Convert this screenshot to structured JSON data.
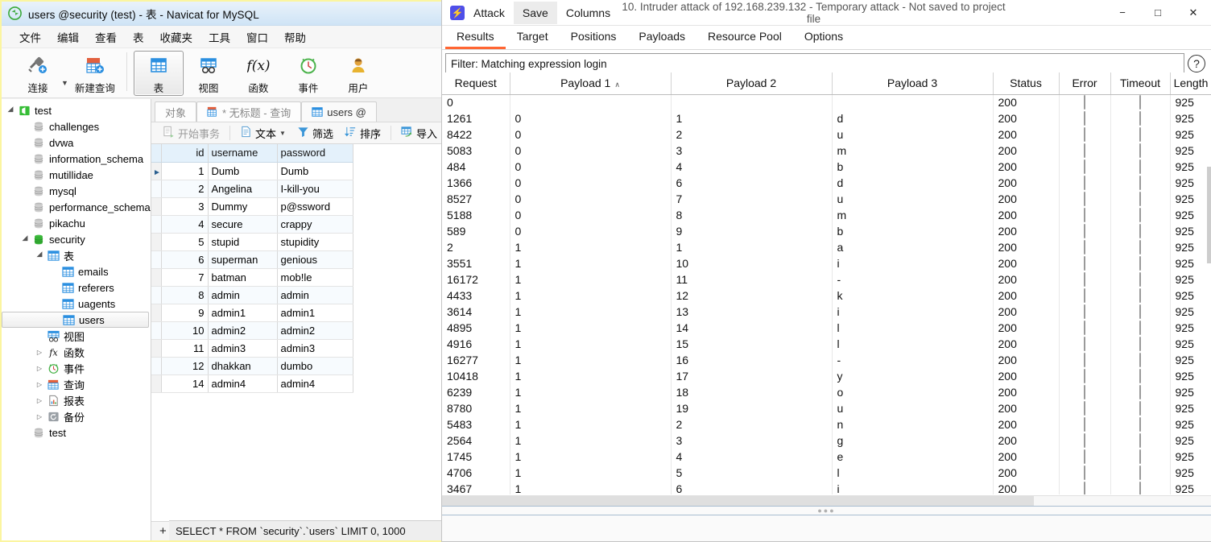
{
  "navicat": {
    "window_title": "users @security (test) - 表 - Navicat for MySQL",
    "app_icon": "navicat-logo-icon",
    "menus": [
      "文件",
      "编辑",
      "查看",
      "表",
      "收藏夹",
      "工具",
      "窗口",
      "帮助"
    ],
    "toolbar": [
      {
        "label": "连接",
        "icon": "connection-icon",
        "selected": false,
        "has_caret": true
      },
      {
        "label": "新建查询",
        "icon": "new-query-icon",
        "selected": false,
        "has_caret": false
      },
      {
        "label": "表",
        "icon": "table-icon",
        "selected": true,
        "has_caret": false
      },
      {
        "label": "视图",
        "icon": "view-icon",
        "selected": false,
        "has_caret": false
      },
      {
        "label": "函数",
        "icon": "function-icon",
        "selected": false,
        "has_caret": false
      },
      {
        "label": "事件",
        "icon": "event-icon",
        "selected": false,
        "has_caret": false
      },
      {
        "label": "用户",
        "icon": "user-icon",
        "selected": false,
        "has_caret": false
      }
    ],
    "tree": [
      {
        "label": "test",
        "icon": "connection-icon",
        "indent": 0,
        "twisty": "open",
        "selected": false
      },
      {
        "label": "challenges",
        "icon": "database-icon",
        "indent": 1,
        "twisty": "none",
        "selected": false
      },
      {
        "label": "dvwa",
        "icon": "database-icon",
        "indent": 1,
        "twisty": "none",
        "selected": false
      },
      {
        "label": "information_schema",
        "icon": "database-icon",
        "indent": 1,
        "twisty": "none",
        "selected": false
      },
      {
        "label": "mutillidae",
        "icon": "database-icon",
        "indent": 1,
        "twisty": "none",
        "selected": false
      },
      {
        "label": "mysql",
        "icon": "database-icon",
        "indent": 1,
        "twisty": "none",
        "selected": false
      },
      {
        "label": "performance_schema",
        "icon": "database-icon",
        "indent": 1,
        "twisty": "none",
        "selected": false
      },
      {
        "label": "pikachu",
        "icon": "database-icon",
        "indent": 1,
        "twisty": "none",
        "selected": false
      },
      {
        "label": "security",
        "icon": "database-open-icon",
        "indent": 1,
        "twisty": "open",
        "selected": false
      },
      {
        "label": "表",
        "icon": "table-folder-icon",
        "indent": 2,
        "twisty": "open",
        "selected": false
      },
      {
        "label": "emails",
        "icon": "table-icon",
        "indent": 3,
        "twisty": "none",
        "selected": false
      },
      {
        "label": "referers",
        "icon": "table-icon",
        "indent": 3,
        "twisty": "none",
        "selected": false
      },
      {
        "label": "uagents",
        "icon": "table-icon",
        "indent": 3,
        "twisty": "none",
        "selected": false
      },
      {
        "label": "users",
        "icon": "table-icon",
        "indent": 3,
        "twisty": "none",
        "selected": true
      },
      {
        "label": "视图",
        "icon": "view-icon",
        "indent": 2,
        "twisty": "none",
        "selected": false
      },
      {
        "label": "函数",
        "icon": "function-icon",
        "indent": 2,
        "twisty": "closed",
        "selected": false
      },
      {
        "label": "事件",
        "icon": "event-icon",
        "indent": 2,
        "twisty": "closed",
        "selected": false
      },
      {
        "label": "查询",
        "icon": "query-icon",
        "indent": 2,
        "twisty": "closed",
        "selected": false
      },
      {
        "label": "报表",
        "icon": "report-icon",
        "indent": 2,
        "twisty": "closed",
        "selected": false
      },
      {
        "label": "备份",
        "icon": "backup-icon",
        "indent": 2,
        "twisty": "closed",
        "selected": false
      },
      {
        "label": "test",
        "icon": "database-icon",
        "indent": 1,
        "twisty": "none",
        "selected": false
      }
    ],
    "tabs": [
      {
        "label": "对象",
        "icon": "",
        "active": false
      },
      {
        "label": "* 无标题 - 查询",
        "icon": "query-icon",
        "active": false
      },
      {
        "label": "users @",
        "icon": "table-icon",
        "active": true
      }
    ],
    "subtoolbar": [
      {
        "label": "开始事务",
        "icon": "transaction-icon",
        "dim": true
      },
      {
        "label": "文本",
        "icon": "text-icon",
        "dim": false,
        "caret": true
      },
      {
        "label": "筛选",
        "icon": "filter-icon",
        "dim": false
      },
      {
        "label": "排序",
        "icon": "sort-icon",
        "dim": false
      },
      {
        "label": "导入",
        "icon": "import-icon",
        "dim": false
      }
    ],
    "grid": {
      "columns": [
        "id",
        "username",
        "password"
      ],
      "rows": [
        {
          "id": "1",
          "username": "Dumb",
          "password": "Dumb",
          "current": true
        },
        {
          "id": "2",
          "username": "Angelina",
          "password": "I-kill-you",
          "current": false
        },
        {
          "id": "3",
          "username": "Dummy",
          "password": "p@ssword",
          "current": false
        },
        {
          "id": "4",
          "username": "secure",
          "password": "crappy",
          "current": false
        },
        {
          "id": "5",
          "username": "stupid",
          "password": "stupidity",
          "current": false
        },
        {
          "id": "6",
          "username": "superman",
          "password": "genious",
          "current": false
        },
        {
          "id": "7",
          "username": "batman",
          "password": "mob!le",
          "current": false
        },
        {
          "id": "8",
          "username": "admin",
          "password": "admin",
          "current": false
        },
        {
          "id": "9",
          "username": "admin1",
          "password": "admin1",
          "current": false
        },
        {
          "id": "10",
          "username": "admin2",
          "password": "admin2",
          "current": false
        },
        {
          "id": "11",
          "username": "admin3",
          "password": "admin3",
          "current": false
        },
        {
          "id": "12",
          "username": "dhakkan",
          "password": "dumbo",
          "current": false
        },
        {
          "id": "14",
          "username": "admin4",
          "password": "admin4",
          "current": false
        }
      ]
    },
    "record_buttons": [
      {
        "icon": "plus-icon",
        "label": "+",
        "dim": false
      },
      {
        "icon": "minus-icon",
        "label": "−",
        "dim": false
      },
      {
        "icon": "check-icon",
        "label": "✓",
        "dim": true
      },
      {
        "icon": "cancel-icon",
        "label": "✕",
        "dim": true
      },
      {
        "icon": "refresh-icon",
        "label": "⟳",
        "dim": false
      },
      {
        "icon": "stop-icon",
        "label": "⃠",
        "dim": false
      }
    ],
    "status_text": "SELECT * FROM `security`.`users` LIMIT 0, 1000"
  },
  "burp": {
    "app_icon": "burp-logo-icon",
    "menu": [
      {
        "label": "Attack",
        "active": false
      },
      {
        "label": "Save",
        "active": true
      },
      {
        "label": "Columns",
        "active": false
      }
    ],
    "window_title": "10. Intruder attack of 192.168.239.132 - Temporary attack - Not saved to project file",
    "window_controls": [
      {
        "name": "minimize-button",
        "glyph": "−"
      },
      {
        "name": "maximize-button",
        "glyph": "□"
      },
      {
        "name": "close-button",
        "glyph": "✕"
      }
    ],
    "tabs": [
      {
        "label": "Results",
        "active": true
      },
      {
        "label": "Target",
        "active": false
      },
      {
        "label": "Positions",
        "active": false
      },
      {
        "label": "Payloads",
        "active": false
      },
      {
        "label": "Resource Pool",
        "active": false
      },
      {
        "label": "Options",
        "active": false
      }
    ],
    "filter": {
      "text": "Filter: Matching expression login",
      "help_icon": "question-mark-icon"
    },
    "results": {
      "columns": [
        {
          "label": "Request",
          "sorted": false
        },
        {
          "label": "Payload 1",
          "sorted": true,
          "sort_glyph": "∧"
        },
        {
          "label": "Payload 2",
          "sorted": false
        },
        {
          "label": "Payload 3",
          "sorted": false
        },
        {
          "label": "Status",
          "sorted": false
        },
        {
          "label": "Error",
          "sorted": false
        },
        {
          "label": "Timeout",
          "sorted": false
        },
        {
          "label": "Length",
          "sorted": false
        }
      ],
      "rows": [
        {
          "request": "0",
          "p1": "",
          "p2": "",
          "p3": "",
          "status": "200",
          "error": false,
          "timeout": false,
          "length": "925"
        },
        {
          "request": "1261",
          "p1": "0",
          "p2": "1",
          "p3": "d",
          "status": "200",
          "error": false,
          "timeout": false,
          "length": "925"
        },
        {
          "request": "8422",
          "p1": "0",
          "p2": "2",
          "p3": "u",
          "status": "200",
          "error": false,
          "timeout": false,
          "length": "925"
        },
        {
          "request": "5083",
          "p1": "0",
          "p2": "3",
          "p3": "m",
          "status": "200",
          "error": false,
          "timeout": false,
          "length": "925"
        },
        {
          "request": "484",
          "p1": "0",
          "p2": "4",
          "p3": "b",
          "status": "200",
          "error": false,
          "timeout": false,
          "length": "925"
        },
        {
          "request": "1366",
          "p1": "0",
          "p2": "6",
          "p3": "d",
          "status": "200",
          "error": false,
          "timeout": false,
          "length": "925"
        },
        {
          "request": "8527",
          "p1": "0",
          "p2": "7",
          "p3": "u",
          "status": "200",
          "error": false,
          "timeout": false,
          "length": "925"
        },
        {
          "request": "5188",
          "p1": "0",
          "p2": "8",
          "p3": "m",
          "status": "200",
          "error": false,
          "timeout": false,
          "length": "925"
        },
        {
          "request": "589",
          "p1": "0",
          "p2": "9",
          "p3": "b",
          "status": "200",
          "error": false,
          "timeout": false,
          "length": "925"
        },
        {
          "request": "2",
          "p1": "1",
          "p2": "1",
          "p3": "a",
          "status": "200",
          "error": false,
          "timeout": false,
          "length": "925"
        },
        {
          "request": "3551",
          "p1": "1",
          "p2": "10",
          "p3": "i",
          "status": "200",
          "error": false,
          "timeout": false,
          "length": "925"
        },
        {
          "request": "16172",
          "p1": "1",
          "p2": "11",
          "p3": "-",
          "status": "200",
          "error": false,
          "timeout": false,
          "length": "925"
        },
        {
          "request": "4433",
          "p1": "1",
          "p2": "12",
          "p3": "k",
          "status": "200",
          "error": false,
          "timeout": false,
          "length": "925"
        },
        {
          "request": "3614",
          "p1": "1",
          "p2": "13",
          "p3": "i",
          "status": "200",
          "error": false,
          "timeout": false,
          "length": "925"
        },
        {
          "request": "4895",
          "p1": "1",
          "p2": "14",
          "p3": "l",
          "status": "200",
          "error": false,
          "timeout": false,
          "length": "925"
        },
        {
          "request": "4916",
          "p1": "1",
          "p2": "15",
          "p3": "l",
          "status": "200",
          "error": false,
          "timeout": false,
          "length": "925"
        },
        {
          "request": "16277",
          "p1": "1",
          "p2": "16",
          "p3": "-",
          "status": "200",
          "error": false,
          "timeout": false,
          "length": "925"
        },
        {
          "request": "10418",
          "p1": "1",
          "p2": "17",
          "p3": "y",
          "status": "200",
          "error": false,
          "timeout": false,
          "length": "925"
        },
        {
          "request": "6239",
          "p1": "1",
          "p2": "18",
          "p3": "o",
          "status": "200",
          "error": false,
          "timeout": false,
          "length": "925"
        },
        {
          "request": "8780",
          "p1": "1",
          "p2": "19",
          "p3": "u",
          "status": "200",
          "error": false,
          "timeout": false,
          "length": "925"
        },
        {
          "request": "5483",
          "p1": "1",
          "p2": "2",
          "p3": "n",
          "status": "200",
          "error": false,
          "timeout": false,
          "length": "925"
        },
        {
          "request": "2564",
          "p1": "1",
          "p2": "3",
          "p3": "g",
          "status": "200",
          "error": false,
          "timeout": false,
          "length": "925"
        },
        {
          "request": "1745",
          "p1": "1",
          "p2": "4",
          "p3": "e",
          "status": "200",
          "error": false,
          "timeout": false,
          "length": "925"
        },
        {
          "request": "4706",
          "p1": "1",
          "p2": "5",
          "p3": "l",
          "status": "200",
          "error": false,
          "timeout": false,
          "length": "925"
        },
        {
          "request": "3467",
          "p1": "1",
          "p2": "6",
          "p3": "i",
          "status": "200",
          "error": false,
          "timeout": false,
          "length": "925"
        }
      ]
    }
  },
  "colors": {
    "burp_accent": "#ff6633",
    "burp_logo": "#4f4fe8",
    "navicat_header": "#e4f1fb",
    "navicat_border": "#fbf5a0"
  }
}
